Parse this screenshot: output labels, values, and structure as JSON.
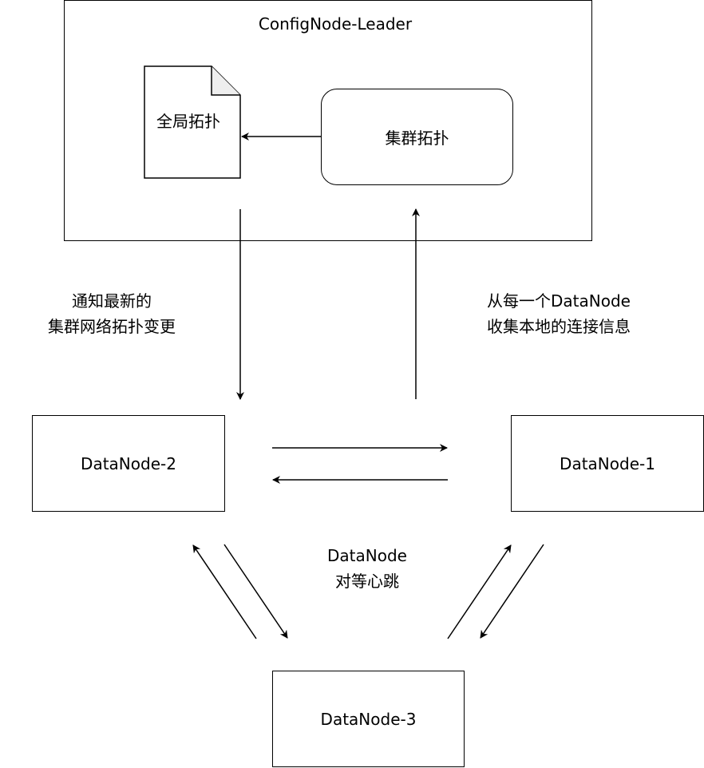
{
  "leader": {
    "title": "ConfigNode-Leader"
  },
  "global_topology": {
    "label": "全局拓扑"
  },
  "cluster_topology": {
    "label": "集群拓扑"
  },
  "notify_label": {
    "line1": "通知最新的",
    "line2": "集群网络拓扑变更"
  },
  "collect_label": {
    "line1": "从每一个DataNode",
    "line2": "收集本地的连接信息"
  },
  "nodes": {
    "dn1": "DataNode-1",
    "dn2": "DataNode-2",
    "dn3": "DataNode-3"
  },
  "heartbeat_label": {
    "line1": "DataNode",
    "line2": "对等心跳"
  }
}
